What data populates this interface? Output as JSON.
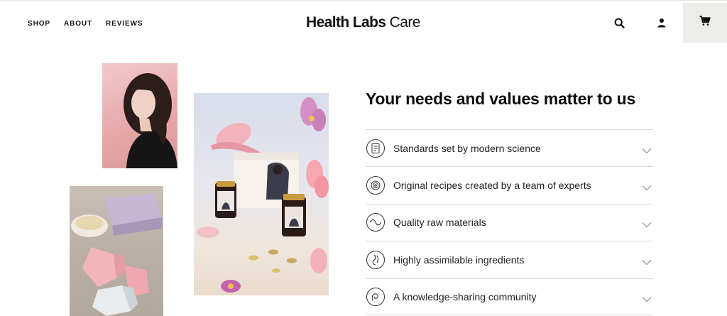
{
  "header": {
    "nav": [
      "SHOP",
      "ABOUT",
      "REVIEWS"
    ],
    "logo_bold": "Health Labs",
    "logo_light": " Care",
    "icons": [
      "search-icon",
      "user-icon",
      "cart-icon"
    ]
  },
  "main": {
    "title": "Your needs and values matter to us",
    "items": [
      {
        "label": "Standards set by modern science",
        "icon": "document-icon"
      },
      {
        "label": "Original recipes created by a team of experts",
        "icon": "spiral-icon"
      },
      {
        "label": "Quality raw materials",
        "icon": "wave-icon"
      },
      {
        "label": "Highly assimilable ingredients",
        "icon": "body-icon"
      },
      {
        "label": "A knowledge-sharing community",
        "icon": "chat-icon"
      }
    ]
  },
  "colors": {
    "text": "#111111",
    "divider": "#d9d9d6",
    "cart_bg": "#ecece8"
  }
}
